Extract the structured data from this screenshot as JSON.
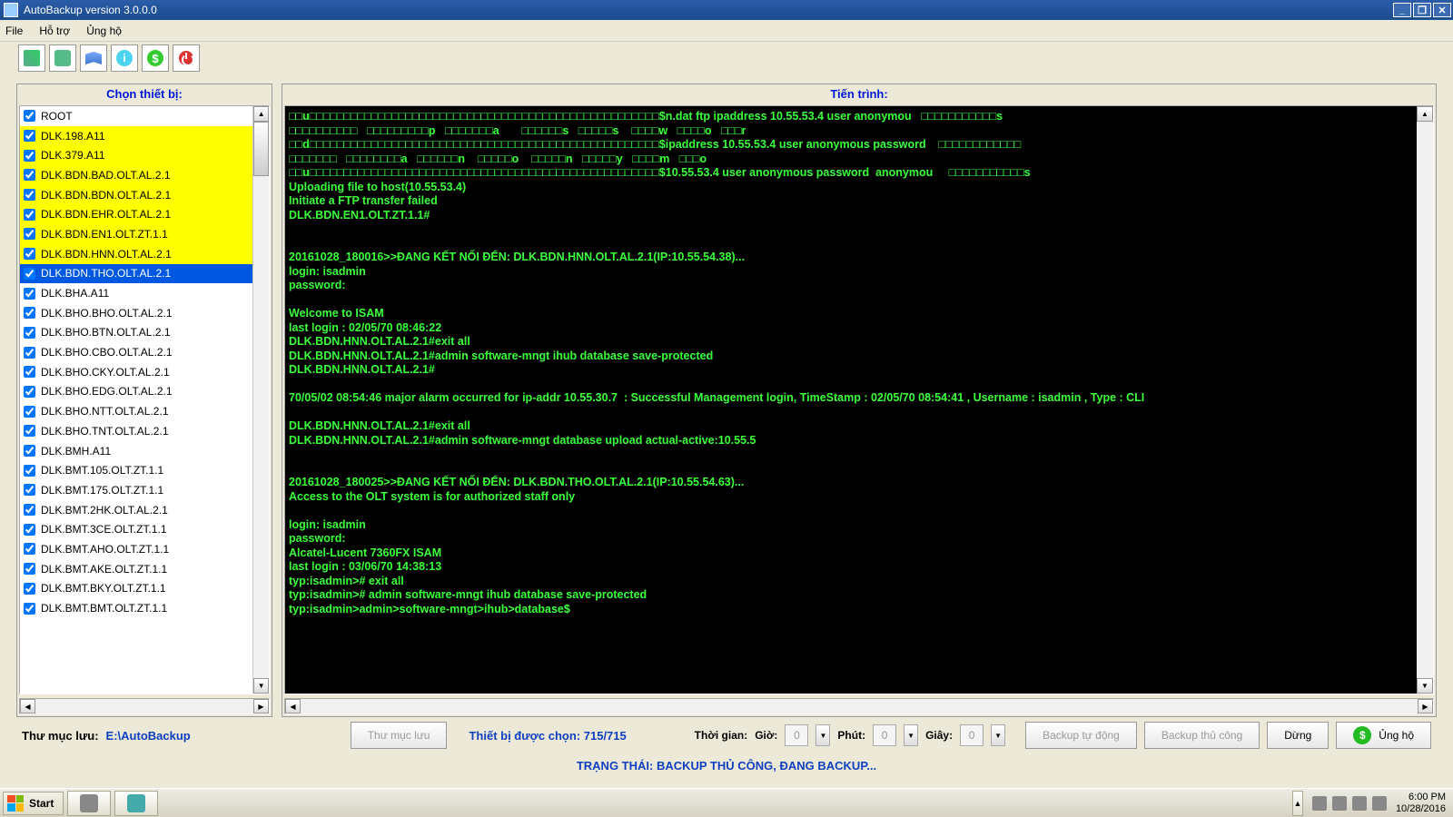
{
  "window": {
    "title": "AutoBackup version 3.0.0.0",
    "min": "_",
    "max": "❐",
    "close": "✕"
  },
  "menu": {
    "file": "File",
    "help": "Hỗ trợ",
    "donate": "Ủng hộ"
  },
  "left": {
    "header": "Chọn thiết bị:",
    "items": [
      {
        "label": "ROOT",
        "bg": "",
        "checked": true
      },
      {
        "label": "DLK.198.A11",
        "bg": "yellow",
        "checked": true
      },
      {
        "label": "DLK.379.A11",
        "bg": "yellow",
        "checked": true
      },
      {
        "label": "DLK.BDN.BAD.OLT.AL.2.1",
        "bg": "yellow",
        "checked": true
      },
      {
        "label": "DLK.BDN.BDN.OLT.AL.2.1",
        "bg": "yellow",
        "checked": true
      },
      {
        "label": "DLK.BDN.EHR.OLT.AL.2.1",
        "bg": "yellow",
        "checked": true
      },
      {
        "label": "DLK.BDN.EN1.OLT.ZT.1.1",
        "bg": "yellow",
        "checked": true
      },
      {
        "label": "DLK.BDN.HNN.OLT.AL.2.1",
        "bg": "yellow",
        "checked": true
      },
      {
        "label": "DLK.BDN.THO.OLT.AL.2.1",
        "bg": "selected",
        "checked": true
      },
      {
        "label": "DLK.BHA.A11",
        "bg": "",
        "checked": true
      },
      {
        "label": "DLK.BHO.BHO.OLT.AL.2.1",
        "bg": "",
        "checked": true
      },
      {
        "label": "DLK.BHO.BTN.OLT.AL.2.1",
        "bg": "",
        "checked": true
      },
      {
        "label": "DLK.BHO.CBO.OLT.AL.2.1",
        "bg": "",
        "checked": true
      },
      {
        "label": "DLK.BHO.CKY.OLT.AL.2.1",
        "bg": "",
        "checked": true
      },
      {
        "label": "DLK.BHO.EDG.OLT.AL.2.1",
        "bg": "",
        "checked": true
      },
      {
        "label": "DLK.BHO.NTT.OLT.AL.2.1",
        "bg": "",
        "checked": true
      },
      {
        "label": "DLK.BHO.TNT.OLT.AL.2.1",
        "bg": "",
        "checked": true
      },
      {
        "label": "DLK.BMH.A11",
        "bg": "",
        "checked": true
      },
      {
        "label": "DLK.BMT.105.OLT.ZT.1.1",
        "bg": "",
        "checked": true
      },
      {
        "label": "DLK.BMT.175.OLT.ZT.1.1",
        "bg": "",
        "checked": true
      },
      {
        "label": "DLK.BMT.2HK.OLT.AL.2.1",
        "bg": "",
        "checked": true
      },
      {
        "label": "DLK.BMT.3CE.OLT.ZT.1.1",
        "bg": "",
        "checked": true
      },
      {
        "label": "DLK.BMT.AHO.OLT.ZT.1.1",
        "bg": "",
        "checked": true
      },
      {
        "label": "DLK.BMT.AKE.OLT.ZT.1.1",
        "bg": "",
        "checked": true
      },
      {
        "label": "DLK.BMT.BKY.OLT.ZT.1.1",
        "bg": "",
        "checked": true
      },
      {
        "label": "DLK.BMT.BMT.OLT.ZT.1.1",
        "bg": "",
        "checked": true
      }
    ]
  },
  "right": {
    "header": "Tiến trình:",
    "lines": [
      "□□u□□□□□□□□□□□□□□□□□□□□□□□□□□□□□□□□□□□□□□□□□□□□□□□□□□□$n.dat ftp ipaddress 10.55.53.4 user anonymou   □□□□□□□□□□□s",
      "□□□□□□□□□□   □□□□□□□□□p   □□□□□□□a       □□□□□□s   □□□□□s    □□□□w   □□□□o   □□□r",
      "□□d□□□□□□□□□□□□□□□□□□□□□□□□□□□□□□□□□□□□□□□□□□□□□□□□□□□$ipaddress 10.55.53.4 user anonymous password    □□□□□□□□□□□□",
      "□□□□□□□   □□□□□□□□a   □□□□□□n    □□□□□o    □□□□□n   □□□□□y   □□□□m   □□□o",
      "□□u□□□□□□□□□□□□□□□□□□□□□□□□□□□□□□□□□□□□□□□□□□□□□□□□□□□$10.55.53.4 user anonymous password  anonymou     □□□□□□□□□□□s",
      "Uploading file to host(10.55.53.4)",
      "Initiate a FTP transfer failed",
      "DLK.BDN.EN1.OLT.ZT.1.1#",
      "",
      "",
      "20161028_180016>>ĐANG KẾT NỐI ĐẾN: DLK.BDN.HNN.OLT.AL.2.1(IP:10.55.54.38)...",
      "login: isadmin",
      "password:",
      "",
      "Welcome to ISAM",
      "last login : 02/05/70 08:46:22",
      "DLK.BDN.HNN.OLT.AL.2.1#exit all",
      "DLK.BDN.HNN.OLT.AL.2.1#admin software-mngt ihub database save-protected",
      "DLK.BDN.HNN.OLT.AL.2.1#",
      "",
      "70/05/02 08:54:46 major alarm occurred for ip-addr 10.55.30.7  : Successful Management login, TimeStamp : 02/05/70 08:54:41 , Username : isadmin , Type : CLI",
      "",
      "DLK.BDN.HNN.OLT.AL.2.1#exit all",
      "DLK.BDN.HNN.OLT.AL.2.1#admin software-mngt database upload actual-active:10.55.5",
      "",
      "",
      "20161028_180025>>ĐANG KẾT NỐI ĐẾN: DLK.BDN.THO.OLT.AL.2.1(IP:10.55.54.63)...",
      "Access to the OLT system is for authorized staff only",
      "",
      "login: isadmin",
      "password:",
      "Alcatel-Lucent 7360FX ISAM",
      "last login : 03/06/70 14:38:13",
      "typ:isadmin># exit all",
      "typ:isadmin># admin software-mngt ihub database save-protected",
      "typ:isadmin>admin>software-mngt>ihub>database$"
    ]
  },
  "bottom": {
    "dir_label": "Thư mục lưu:",
    "dir_value": "E:\\AutoBackup",
    "btn_dir": "Thư mục lưu",
    "selected_label": "Thiết bị được chọn:",
    "selected_value": "715/715",
    "time_block_label": "Thời gian:",
    "hour_label": "Giờ:",
    "hour_val": "0",
    "min_label": "Phút:",
    "min_val": "0",
    "sec_label": "Giây:",
    "sec_val": "0",
    "btn_auto": "Backup tự động",
    "btn_manual": "Backup thủ công",
    "btn_stop": "Dừng",
    "btn_donate": "Ủng hộ"
  },
  "status": "TRẠNG THÁI: BACKUP THỦ CÔNG, ĐANG BACKUP...",
  "taskbar": {
    "start": "Start",
    "time": "6:00 PM",
    "date": "10/28/2016"
  }
}
